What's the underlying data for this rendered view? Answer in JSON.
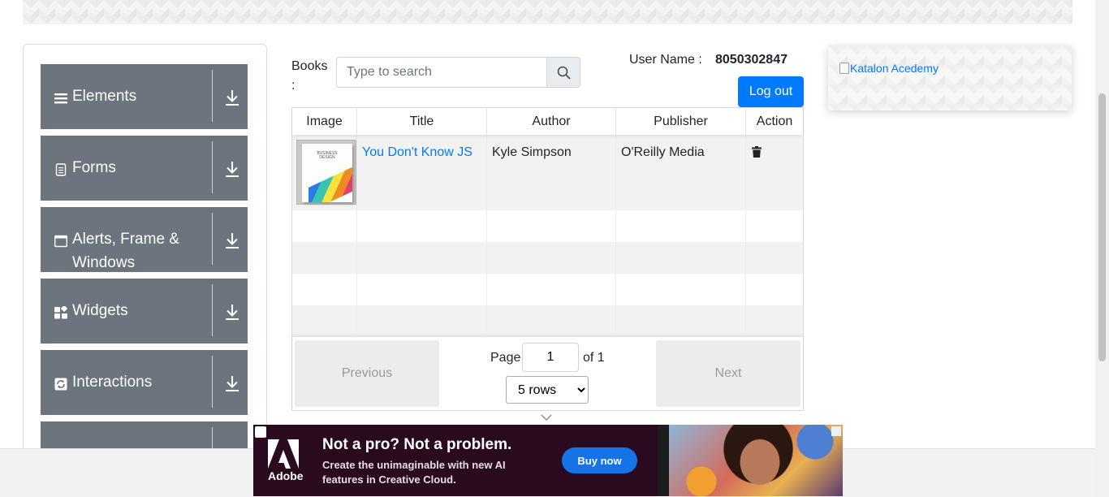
{
  "sidebar": {
    "groups": [
      {
        "title": "Elements",
        "icon": "hamburger-icon"
      },
      {
        "title": "Forms",
        "icon": "document-icon"
      },
      {
        "title": "Alerts, Frame & Windows",
        "icon": "window-icon"
      },
      {
        "title": "Widgets",
        "icon": "widgets-icon"
      },
      {
        "title": "Interactions",
        "icon": "refresh-icon"
      },
      {
        "title": "",
        "icon": "partial-icon"
      }
    ]
  },
  "books": {
    "label": "Books :",
    "search_placeholder": "Type to search"
  },
  "user": {
    "label": "User Name :",
    "value": "8050302847",
    "logout_label": "Log out"
  },
  "ad_side": {
    "link_text": "Katalon Acedemy"
  },
  "table": {
    "headers": [
      "Image",
      "Title",
      "Author",
      "Publisher",
      "Action"
    ],
    "rows": [
      {
        "title": "You Don't Know JS",
        "author": "Kyle Simpson",
        "publisher": "O'Reilly Media",
        "cover_text": "BUSINESS DESIGN"
      }
    ]
  },
  "pagination": {
    "previous_label": "Previous",
    "next_label": "Next",
    "page_label": "Page",
    "page_value": "1",
    "of_label": "of 1",
    "rows_option": "5 rows"
  },
  "ad_bottom": {
    "brand": "Adobe",
    "headline": "Not a pro? Not a problem.",
    "subtext": "Create the unimaginable with new AI features in Creative Cloud.",
    "button": "Buy now"
  },
  "colors": {
    "sidebar_group_bg": "#6c757d",
    "primary": "#007bff",
    "ad_bg": "#2a0a1f",
    "ad_button": "#1473e6"
  }
}
